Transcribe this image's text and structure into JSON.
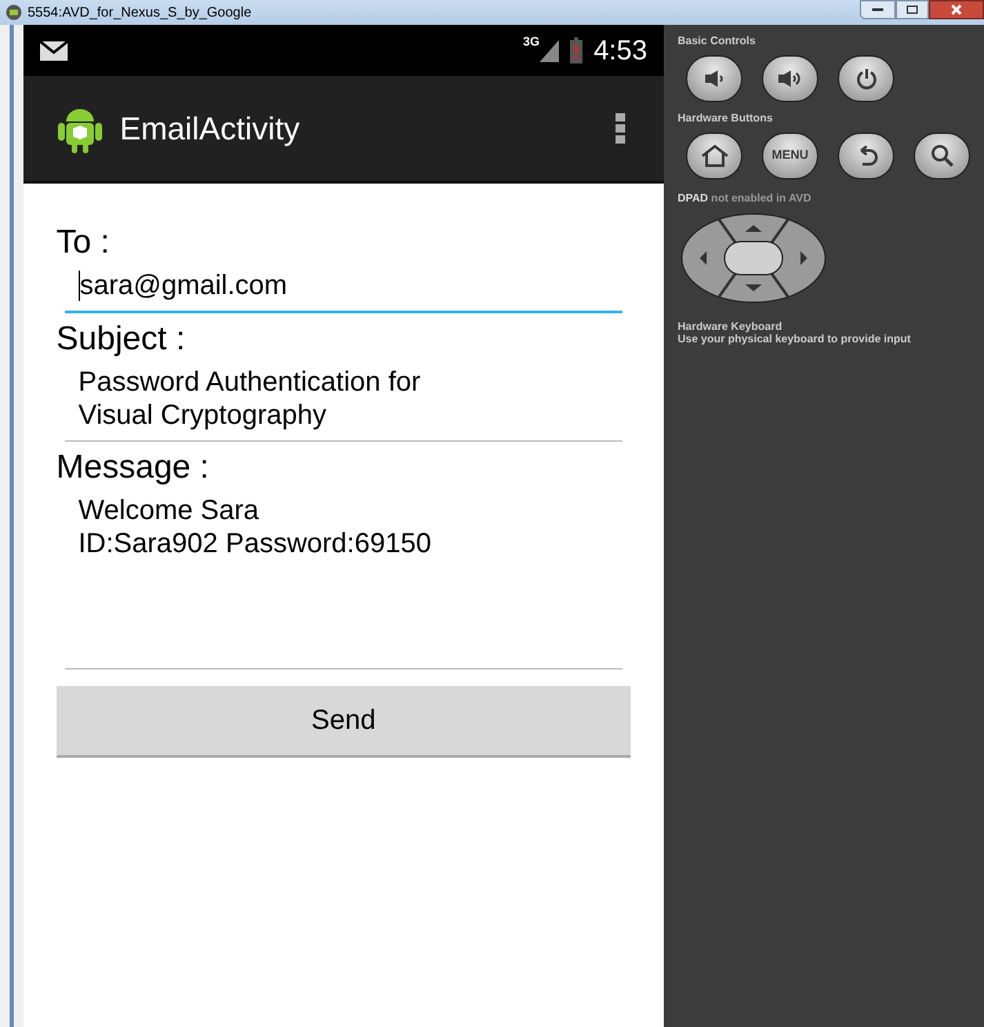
{
  "window": {
    "title": "5554:AVD_for_Nexus_S_by_Google"
  },
  "status_bar": {
    "network": "3G",
    "time": "4:53"
  },
  "action_bar": {
    "title": "EmailActivity"
  },
  "form": {
    "fields": [
      {
        "label": "To :",
        "value": "sara@gmail.com",
        "focused": true,
        "kind": "line"
      },
      {
        "label": "Subject :",
        "value": "Password Authentication for\nVisual Cryptography",
        "focused": false,
        "kind": "text"
      },
      {
        "label": "Message :",
        "value": "Welcome Sara\nID:Sara902 Password:69150",
        "focused": false,
        "kind": "area"
      }
    ],
    "send_button": "Send"
  },
  "controls": {
    "basic_title": "Basic Controls",
    "basic_buttons": [
      {
        "kind": "volume-down"
      },
      {
        "kind": "volume-up"
      },
      {
        "kind": "power"
      }
    ],
    "hardware_title": "Hardware Buttons",
    "hardware_buttons": [
      {
        "kind": "home"
      },
      {
        "kind": "menu",
        "label": "MENU"
      },
      {
        "kind": "back"
      },
      {
        "kind": "search"
      }
    ],
    "dpad_note": "**DPAD** not enabled in AVD",
    "keyboard_title": "Hardware Keyboard",
    "keyboard_note": "Use your physical keyboard to provide input"
  }
}
